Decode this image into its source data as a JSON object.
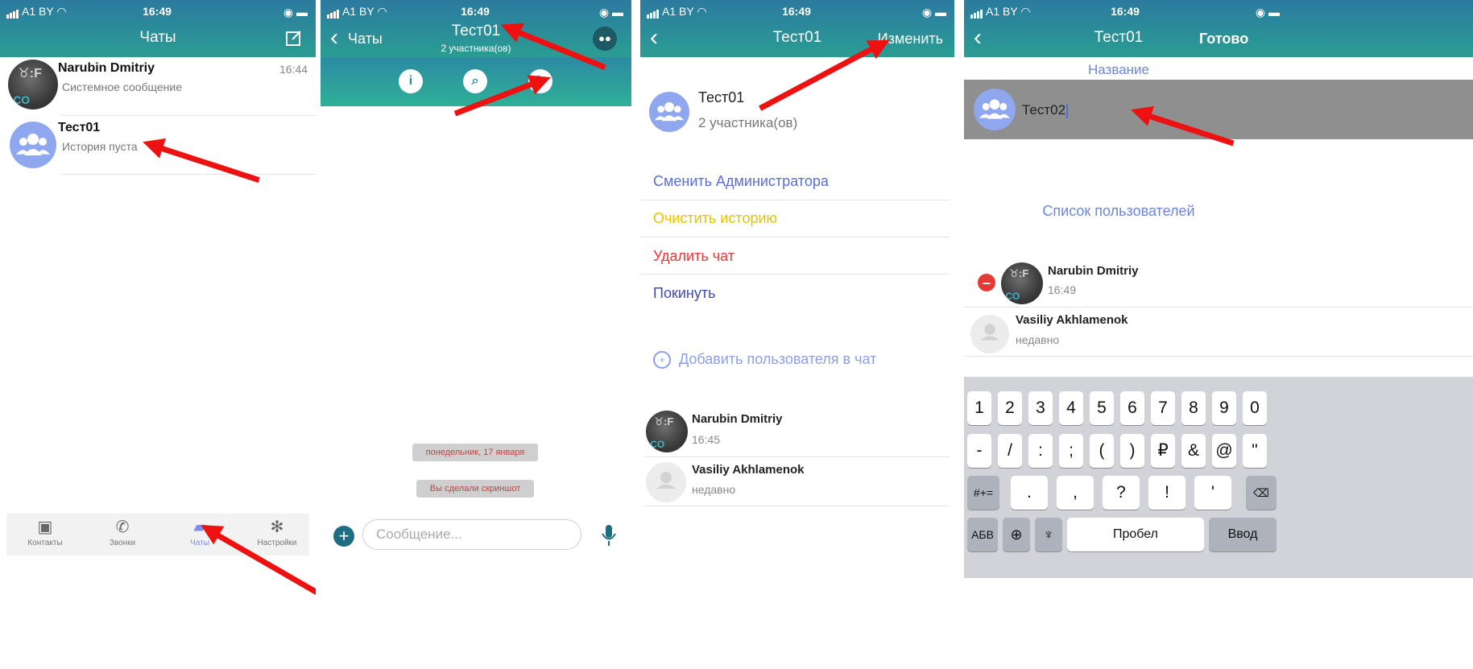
{
  "status_bar": {
    "carrier": "A1 BY",
    "time": "16:49"
  },
  "screen1": {
    "title": "Чаты",
    "chats": [
      {
        "name": "Narubin Dmitriy",
        "preview": "Системное сообщение",
        "time": "16:44"
      },
      {
        "name": "Тест01",
        "preview": "История пуста",
        "time": ""
      }
    ],
    "tabs": [
      {
        "label": "Контакты",
        "icon": "contacts-icon"
      },
      {
        "label": "Звонки",
        "icon": "phone-icon"
      },
      {
        "label": "Чаты",
        "icon": "chats-icon"
      },
      {
        "label": "Настройки",
        "icon": "gear-icon"
      }
    ]
  },
  "screen2": {
    "back_label": "Чаты",
    "title": "Тест01",
    "subtitle": "2 участника(ов)",
    "date_pill": "понедельник, 17 января",
    "screenshot_pill": "Вы сделали скриншот",
    "message_placeholder": "Сообщение..."
  },
  "screen3": {
    "title": "Тест01",
    "edit_label": "Изменить",
    "chat_name": "Тест01",
    "members_count": "2 участника(ов)",
    "actions": {
      "change_admin": "Сменить Администратора",
      "clear_history": "Очистить историю",
      "delete_chat": "Удалить чат",
      "leave": "Покинуть"
    },
    "add_user": "Добавить пользователя в чат",
    "members": [
      {
        "name": "Narubin Dmitriy",
        "status": "16:45"
      },
      {
        "name": "Vasiliy Akhlamenok",
        "status": "недавно"
      }
    ],
    "colors": {
      "change_admin": "#5a6fd6",
      "clear_history": "#e6c300",
      "delete_chat": "#e53935",
      "leave": "#3f4ab8"
    }
  },
  "screen4": {
    "title": "Тест01",
    "done_label": "Готово",
    "name_section": "Название",
    "name_value": "Тест02",
    "users_section": "Список пользователей",
    "members": [
      {
        "name": "Narubin Dmitriy",
        "status": "16:49"
      },
      {
        "name": "Vasiliy Akhlamenok",
        "status": "недавно"
      }
    ],
    "keyboard": {
      "row1": [
        "1",
        "2",
        "3",
        "4",
        "5",
        "6",
        "7",
        "8",
        "9",
        "0"
      ],
      "row2": [
        "-",
        "/",
        ":",
        ";",
        "(",
        ")",
        "₽",
        "&",
        "@",
        "\""
      ],
      "row3": [
        ".",
        ",",
        "?",
        "!",
        "'"
      ],
      "symbols_key": "#+=",
      "letters_key": "АБВ",
      "space_key": "Пробел",
      "enter_key": "Ввод"
    }
  },
  "avatar_marks": {
    "logo_mark": "♉:F",
    "logo_co": "CO"
  }
}
